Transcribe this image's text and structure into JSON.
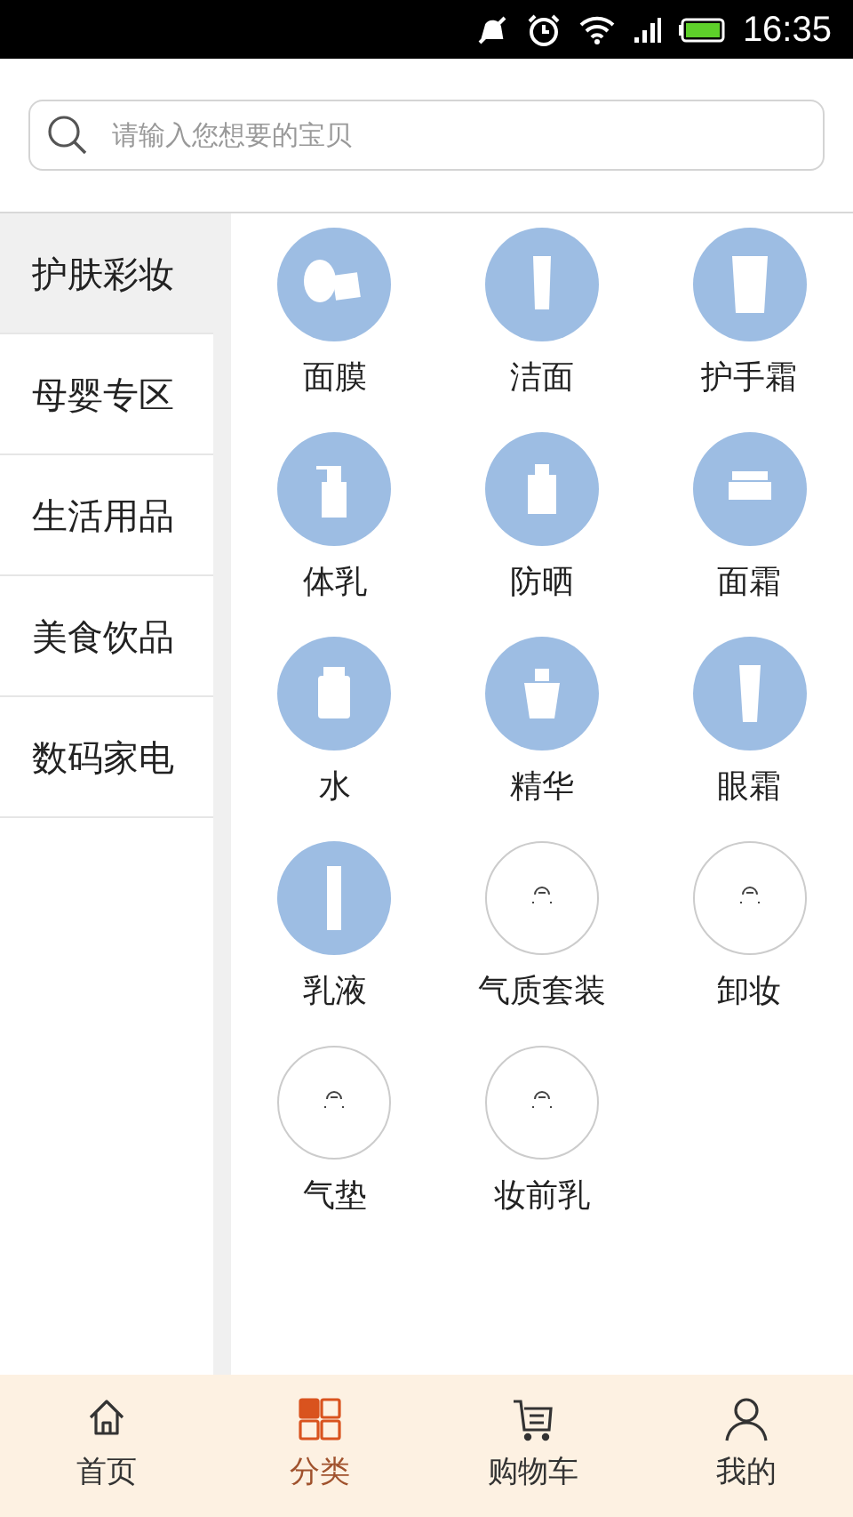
{
  "status_bar": {
    "time": "16:35"
  },
  "search": {
    "placeholder": "请输入您想要的宝贝"
  },
  "sidebar": {
    "items": [
      {
        "label": "护肤彩妆",
        "selected": true
      },
      {
        "label": "母婴专区",
        "selected": false
      },
      {
        "label": "生活用品",
        "selected": false
      },
      {
        "label": "美食饮品",
        "selected": false
      },
      {
        "label": "数码家电",
        "selected": false
      }
    ]
  },
  "categories": [
    {
      "label": "面膜",
      "kind": "image"
    },
    {
      "label": "洁面",
      "kind": "image"
    },
    {
      "label": "护手霜",
      "kind": "image"
    },
    {
      "label": "体乳",
      "kind": "image"
    },
    {
      "label": "防晒",
      "kind": "image"
    },
    {
      "label": "面霜",
      "kind": "image"
    },
    {
      "label": "水",
      "kind": "image"
    },
    {
      "label": "精华",
      "kind": "image"
    },
    {
      "label": "眼霜",
      "kind": "image"
    },
    {
      "label": "乳液",
      "kind": "image"
    },
    {
      "label": "气质套装",
      "kind": "placeholder"
    },
    {
      "label": "卸妆",
      "kind": "placeholder"
    },
    {
      "label": "气垫",
      "kind": "placeholder"
    },
    {
      "label": "妆前乳",
      "kind": "placeholder"
    }
  ],
  "tab_bar": [
    {
      "label": "首页",
      "selected": false
    },
    {
      "label": "分类",
      "selected": true
    },
    {
      "label": "购物车",
      "selected": false
    },
    {
      "label": "我的",
      "selected": false
    }
  ]
}
